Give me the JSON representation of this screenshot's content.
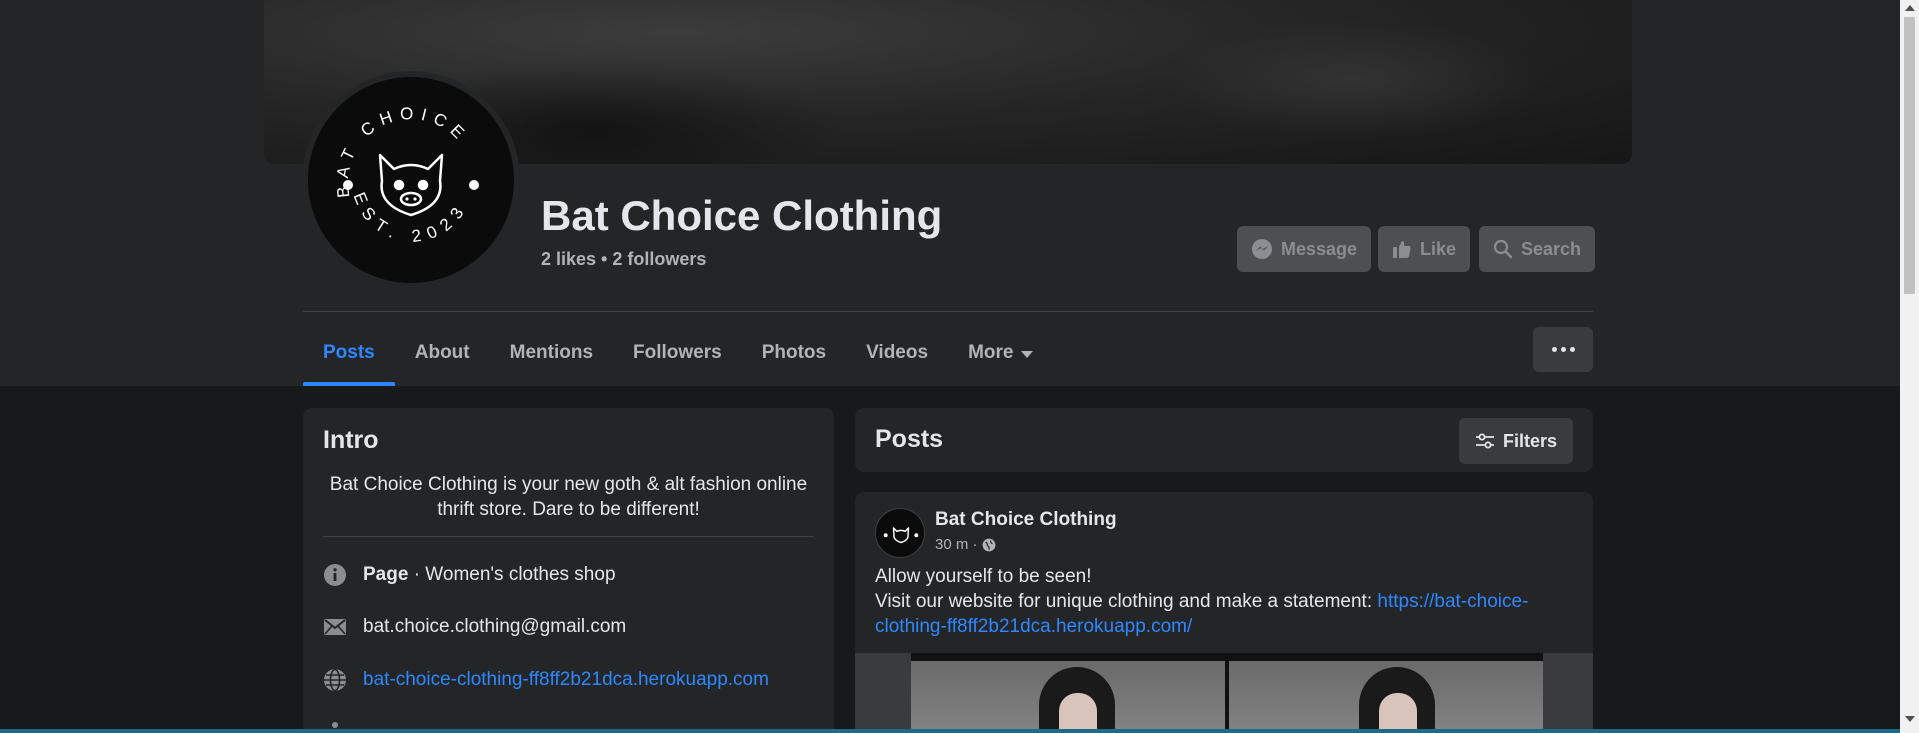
{
  "profile": {
    "name": "Bat Choice Clothing",
    "stats": "2 likes • 2 followers",
    "logo_text_top": "BAT CHOICE",
    "logo_text_bottom": "EST. 2023"
  },
  "actions": {
    "message": "Message",
    "like": "Like",
    "search": "Search"
  },
  "tabs": [
    {
      "label": "Posts",
      "active": true
    },
    {
      "label": "About"
    },
    {
      "label": "Mentions"
    },
    {
      "label": "Followers"
    },
    {
      "label": "Photos"
    },
    {
      "label": "Videos"
    },
    {
      "label": "More"
    }
  ],
  "intro": {
    "title": "Intro",
    "bio": "Bat Choice Clothing is your new goth & alt fashion online thrift store. Dare to be different!",
    "category_label": "Page",
    "category_value": " · Women's clothes shop",
    "email": "bat.choice.clothing@gmail.com",
    "website": "bat-choice-clothing-ff8ff2b21dca.herokuapp.com"
  },
  "posts": {
    "title": "Posts",
    "filters": "Filters"
  },
  "post": {
    "author": "Bat Choice Clothing",
    "time": "30 m ·",
    "line1": "Allow yourself to be seen!",
    "line2": "Visit our website for unique clothing and make a statement: ",
    "link": "https://bat-choice-clothing-ff8ff2b21dca.herokuapp.com/"
  },
  "colors": {
    "background": "#18191a",
    "card": "#242526",
    "accent": "#2d88ff",
    "text_primary": "#e4e6eb",
    "text_secondary": "#b0b3b8"
  }
}
